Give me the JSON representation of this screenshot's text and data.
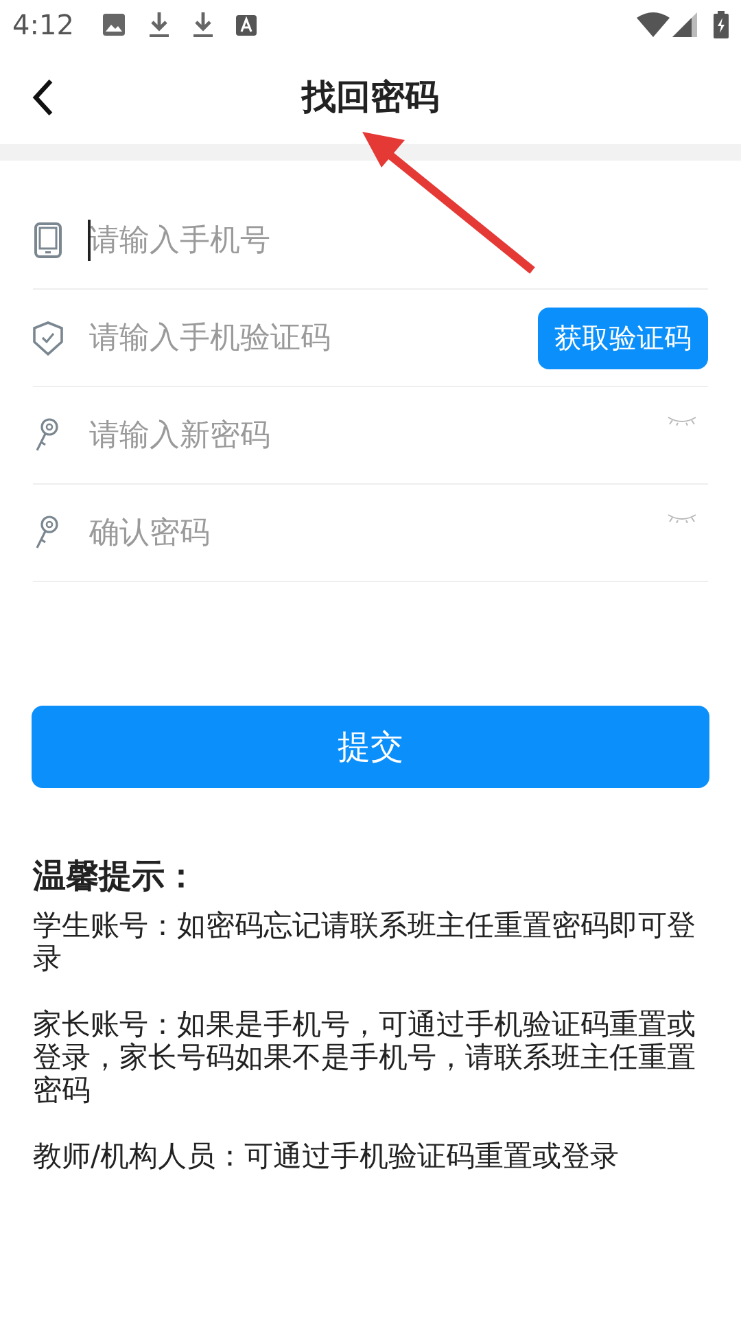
{
  "status_bar": {
    "time": "4:12"
  },
  "header": {
    "title": "找回密码"
  },
  "fields": [
    {
      "kind": "phone",
      "placeholder": "请输入手机号",
      "focused": true
    },
    {
      "kind": "code",
      "placeholder": "请输入手机验证码",
      "focused": false,
      "button": "获取验证码"
    },
    {
      "kind": "password",
      "placeholder": "请输入新密码",
      "focused": false
    },
    {
      "kind": "password",
      "placeholder": "确认密码",
      "focused": false
    }
  ],
  "submit": "提交",
  "tips": {
    "title": "温馨提示：",
    "items": [
      "学生账号：如密码忘记请联系班主任重置密码即可登录",
      "家长账号：如果是手机号，可通过手机验证码重置或登录，家长号码如果不是手机号，请联系班主任重置密码",
      "教师/机构人员：可通过手机验证码重置或登录"
    ]
  }
}
